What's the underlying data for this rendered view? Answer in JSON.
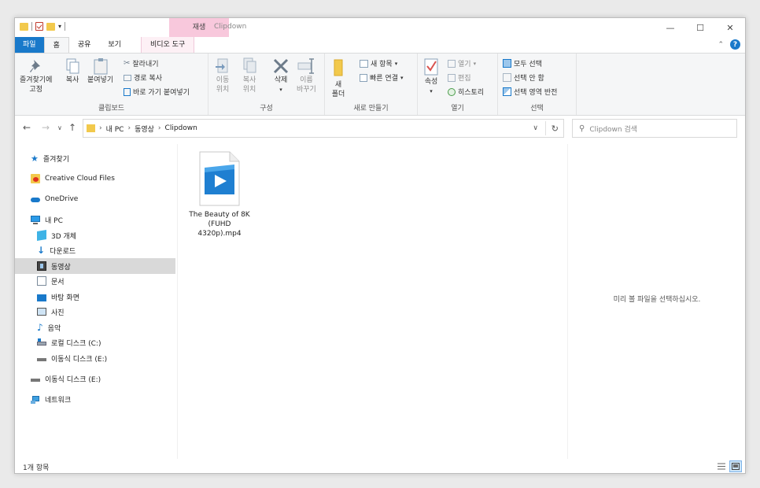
{
  "titlebar": {
    "context_tab_header": "재생",
    "title": "Clipdown"
  },
  "tabs": {
    "file": "파일",
    "home": "홈",
    "share": "공유",
    "view": "보기",
    "video_tools": "비디오 도구"
  },
  "ribbon": {
    "clipboard": {
      "label": "클립보드",
      "pin_line1": "즐겨찾기에",
      "pin_line2": "고정",
      "copy": "복사",
      "paste": "붙여넣기",
      "cut": "잘라내기",
      "copy_path": "경로 복사",
      "paste_shortcut": "바로 가기 붙여넣기"
    },
    "organize": {
      "label": "구성",
      "move_to_line1": "이동",
      "move_to_line2": "위치",
      "copy_to_line1": "복사",
      "copy_to_line2": "위치",
      "delete": "삭제",
      "rename_line1": "이름",
      "rename_line2": "바꾸기"
    },
    "new": {
      "label": "새로 만들기",
      "new_folder_line1": "새",
      "new_folder_line2": "폴더",
      "new_item": "새 항목",
      "easy_access": "빠른 연결"
    },
    "open": {
      "label": "열기",
      "properties": "속성",
      "open": "열기",
      "edit": "편집",
      "history": "히스토리"
    },
    "select": {
      "label": "선택",
      "select_all": "모두 선택",
      "select_none": "선택 안 함",
      "invert": "선택 영역 반전"
    }
  },
  "address_bar": {
    "segments": [
      "내 PC",
      "동영상",
      "Clipdown"
    ],
    "search_placeholder": "Clipdown 검색"
  },
  "sidebar": {
    "quick_access": "즐겨찾기",
    "creative_cloud": "Creative Cloud Files",
    "onedrive": "OneDrive",
    "this_pc": "내 PC",
    "objects_3d": "3D 개체",
    "downloads": "다운로드",
    "videos": "동영상",
    "documents": "문서",
    "desktop": "바탕 화면",
    "pictures": "사진",
    "music": "음악",
    "local_disk": "로컬 디스크 (C:)",
    "removable_1": "이동식 디스크 (E:)",
    "removable_2": "이동식 디스크 (E:)",
    "network": "네트워크"
  },
  "files": [
    {
      "name": "The Beauty of 8K (FUHD 4320p).mp4"
    }
  ],
  "preview_message": "미리 볼 파일을 선택하십시오.",
  "status": {
    "item_count": "1개 항목"
  },
  "colors": {
    "accent": "#1979ca",
    "context_tab": "#f8c8dc",
    "folder": "#f2c94c",
    "selected_nav": "#d9d9d9"
  }
}
